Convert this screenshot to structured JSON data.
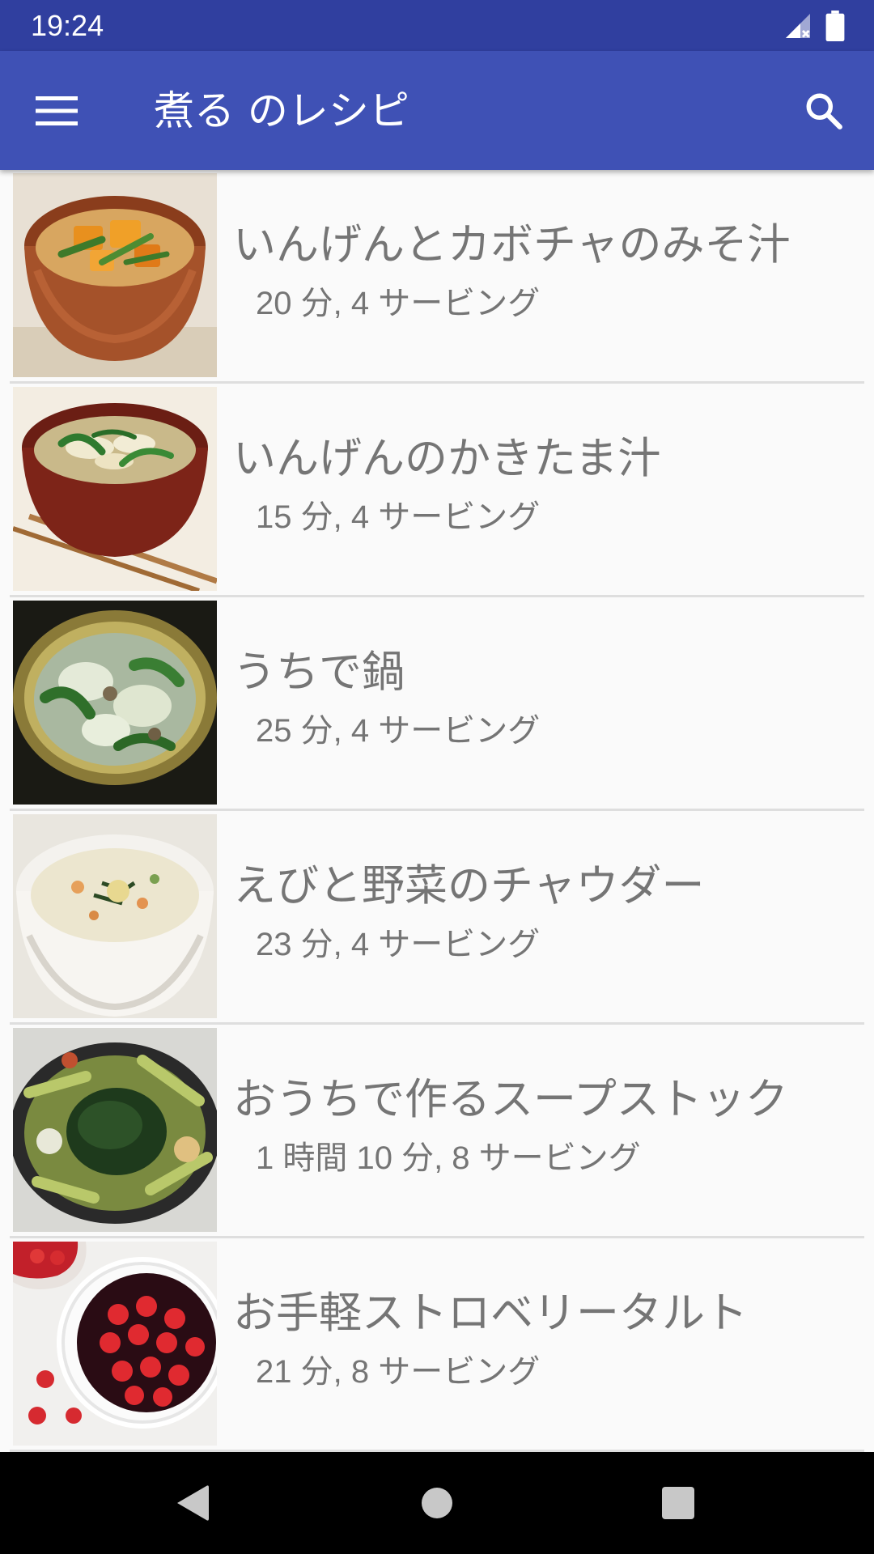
{
  "status_bar": {
    "time": "19:24",
    "icons": [
      "signal-no-data-icon",
      "battery-full-icon"
    ]
  },
  "app_bar": {
    "title": "煮る のレシピ",
    "menu_icon": "hamburger-menu-icon",
    "search_icon": "search-icon",
    "color": "#3f51b5",
    "status_color": "#303f9f"
  },
  "recipes": [
    {
      "title": "いんげんとカボチャのみそ汁",
      "meta": "20 分, 4 サービング",
      "image": "miso-soup-pumpkin-green-beans"
    },
    {
      "title": "いんげんのかきたま汁",
      "meta": "15 分, 4 サービング",
      "image": "egg-drop-soup-green-beans"
    },
    {
      "title": "うちで鍋",
      "meta": "25 分, 4 サービング",
      "image": "home-hot-pot"
    },
    {
      "title": "えびと野菜のチャウダー",
      "meta": "23 分, 4 サービング",
      "image": "shrimp-vegetable-chowder"
    },
    {
      "title": "おうちで作るスープストック",
      "meta": "1 時間 10 分, 8 サービング",
      "image": "homemade-soup-stock"
    },
    {
      "title": "お手軽ストロベリータルト",
      "meta": "21 分, 8 サービング",
      "image": "easy-strawberry-tart"
    }
  ],
  "nav_bar": {
    "back_icon": "back-triangle-icon",
    "home_icon": "home-circle-icon",
    "recents_icon": "recents-square-icon"
  }
}
